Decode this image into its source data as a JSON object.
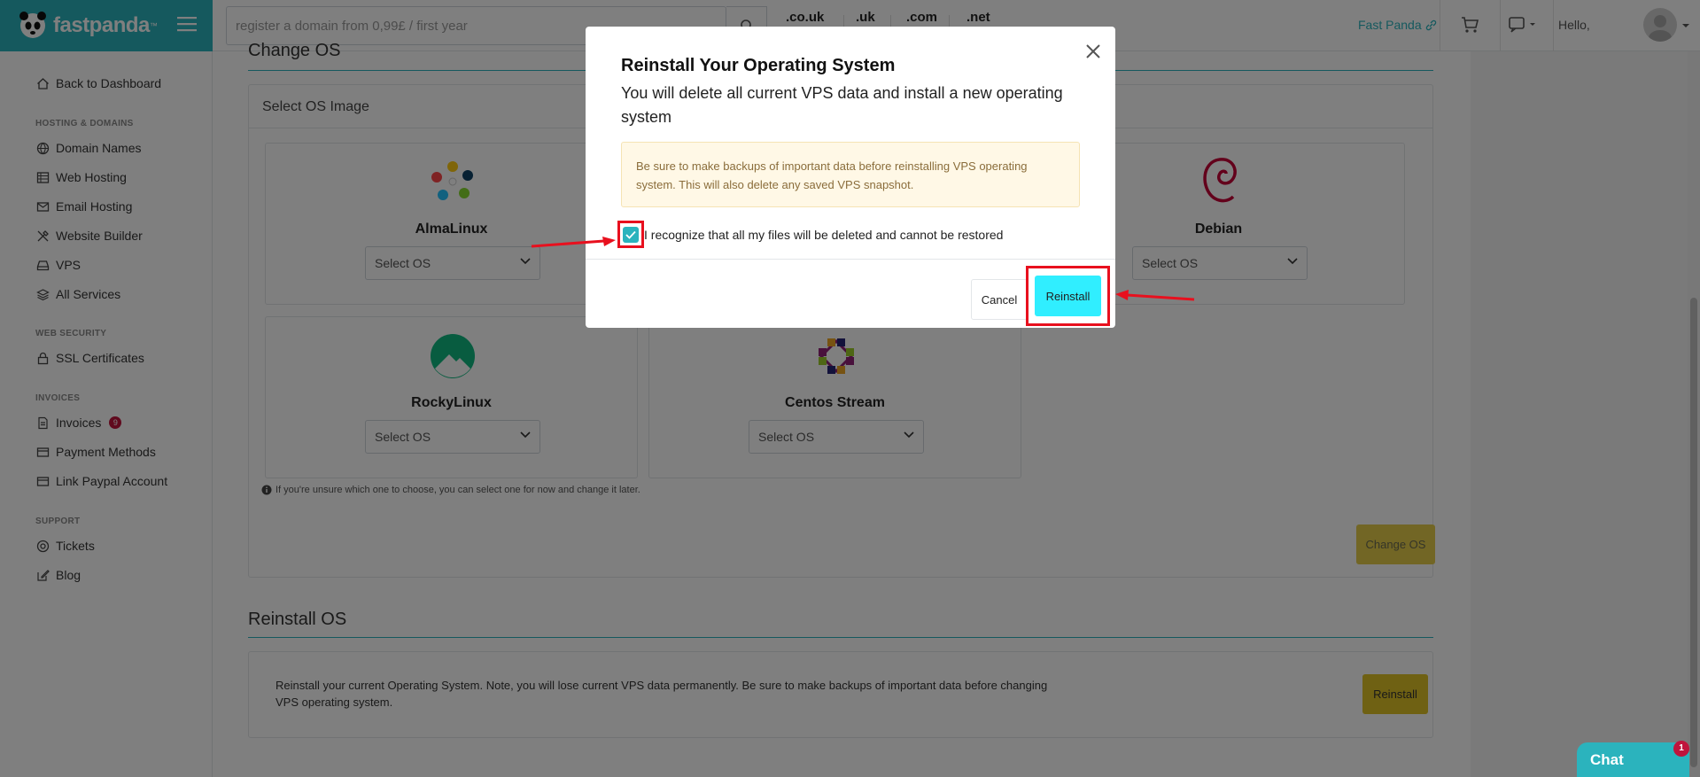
{
  "brand": {
    "name": "fastpanda",
    "tm": "™"
  },
  "search": {
    "placeholder": "register a domain from 0,99£ / first year"
  },
  "tlds": [
    ".co.uk",
    ".uk",
    ".com",
    ".net"
  ],
  "topbar": {
    "fast_panda_link": "Fast Panda",
    "hello": "Hello,"
  },
  "sidebar": {
    "back": "Back to Dashboard",
    "heading_hosting": "HOSTING & DOMAINS",
    "items_hosting": [
      "Domain Names",
      "Web Hosting",
      "Email Hosting",
      "Website Builder",
      "VPS",
      "All Services"
    ],
    "heading_security": "WEB SECURITY",
    "ssl": "SSL Certificates",
    "heading_invoices": "INVOICES",
    "invoices": "Invoices",
    "invoices_badge": "9",
    "payment_methods": "Payment Methods",
    "link_paypal": "Link Paypal Account",
    "heading_support": "SUPPORT",
    "tickets": "Tickets",
    "blog": "Blog"
  },
  "change_os": {
    "title": "Change OS",
    "card_title": "Select OS Image",
    "tiles": [
      {
        "name": "AlmaLinux",
        "select": "Select OS"
      },
      {
        "name": "Debian",
        "select": "Select OS"
      },
      {
        "name": "RockyLinux",
        "select": "Select OS"
      },
      {
        "name": "Centos Stream",
        "select": "Select OS"
      }
    ],
    "hint": "If you're unsure which one to choose, you can select one for now and change it later.",
    "button": "Change OS"
  },
  "reinstall_os": {
    "title": "Reinstall OS",
    "text": "Reinstall your current Operating System. Note, you will lose current VPS data permanently. Be sure to make backups of important data before changing VPS operating system.",
    "button": "Reinstall"
  },
  "modal": {
    "title": "Reinstall Your Operating System",
    "subtitle": "You will delete all current VPS data and install a new operating system",
    "warning": "Be sure to make backups of important data before reinstalling VPS operating system. This will also delete any saved VPS snapshot.",
    "checkbox_label": "I recognize that all my files will be deleted and cannot be restored",
    "checkbox_checked": true,
    "cancel": "Cancel",
    "reinstall": "Reinstall"
  },
  "chat": {
    "label": "Chat",
    "badge": "1"
  },
  "colors": {
    "accent": "#2bb3bd",
    "yellow": "#dfc226",
    "cyan_button": "#30eeff",
    "highlight": "#e8101e"
  }
}
